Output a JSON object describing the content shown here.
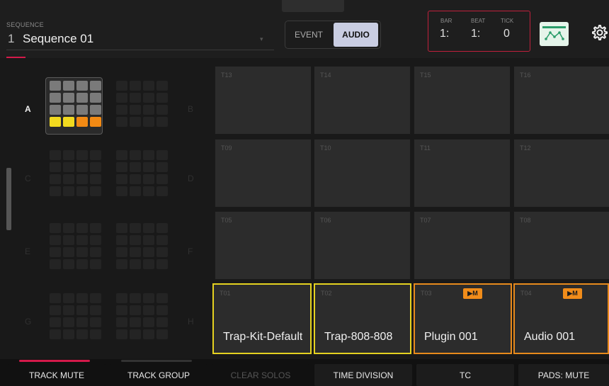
{
  "header": {
    "sequence_label": "SEQUENCE",
    "sequence_number": "1",
    "sequence_name": "Sequence 01",
    "mode_event": "EVENT",
    "mode_audio": "AUDIO",
    "time": {
      "bar_label": "BAR",
      "bar": "1:",
      "beat_label": "BEAT",
      "beat": "1:",
      "tick_label": "TICK",
      "tick": "0"
    },
    "automation_icon": "automation-curve-icon",
    "settings_icon": "gear-icon"
  },
  "banks": {
    "a_label": "A",
    "b_label": "B",
    "c_label": "C",
    "d_label": "D",
    "e_label": "E",
    "f_label": "F",
    "g_label": "G",
    "h_label": "H"
  },
  "pads": [
    {
      "num": "T13",
      "name": ""
    },
    {
      "num": "T14",
      "name": ""
    },
    {
      "num": "T15",
      "name": ""
    },
    {
      "num": "T16",
      "name": ""
    },
    {
      "num": "T09",
      "name": ""
    },
    {
      "num": "T10",
      "name": ""
    },
    {
      "num": "T11",
      "name": ""
    },
    {
      "num": "T12",
      "name": ""
    },
    {
      "num": "T05",
      "name": ""
    },
    {
      "num": "T06",
      "name": ""
    },
    {
      "num": "T07",
      "name": ""
    },
    {
      "num": "T08",
      "name": ""
    },
    {
      "num": "T01",
      "name": "Trap-Kit-Default"
    },
    {
      "num": "T02",
      "name": "Trap-808-808"
    },
    {
      "num": "T03",
      "name": "Plugin 001",
      "badge": "▶M"
    },
    {
      "num": "T04",
      "name": "Audio 001",
      "badge": "▶M"
    }
  ],
  "bottom": {
    "track_mute": "TRACK MUTE",
    "track_group": "TRACK GROUP",
    "clear_solos": "CLEAR SOLOS",
    "time_division": "TIME DIVISION",
    "tc": "TC",
    "pads_mute": "PADS: MUTE"
  },
  "colors": {
    "accent_red": "#d41a4a",
    "pad_yellow": "#e5d220",
    "pad_orange": "#e88a1c",
    "audio_button": "#c9cde2"
  }
}
